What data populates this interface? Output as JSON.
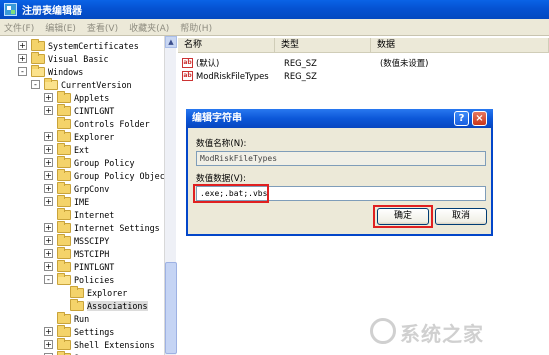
{
  "window": {
    "title": "注册表编辑器",
    "icon": "registry-icon"
  },
  "menu": [
    "文件(F)",
    "编辑(E)",
    "查看(V)",
    "收藏夹(A)",
    "帮助(H)"
  ],
  "tree": [
    {
      "label": "SystemCertificates",
      "exp": "+",
      "depth": 1
    },
    {
      "label": "Visual Basic",
      "exp": "+",
      "depth": 1
    },
    {
      "label": "Windows",
      "exp": "-",
      "depth": 1
    },
    {
      "label": "CurrentVersion",
      "exp": "-",
      "depth": 2
    },
    {
      "label": "Applets",
      "exp": "+",
      "depth": 3
    },
    {
      "label": "CINTLGNT",
      "exp": "+",
      "depth": 3
    },
    {
      "label": "Controls Folder",
      "exp": "",
      "depth": 3
    },
    {
      "label": "Explorer",
      "exp": "+",
      "depth": 3
    },
    {
      "label": "Ext",
      "exp": "+",
      "depth": 3
    },
    {
      "label": "Group Policy",
      "exp": "+",
      "depth": 3
    },
    {
      "label": "Group Policy Objec",
      "exp": "+",
      "depth": 3
    },
    {
      "label": "GrpConv",
      "exp": "+",
      "depth": 3
    },
    {
      "label": "IME",
      "exp": "+",
      "depth": 3
    },
    {
      "label": "Internet",
      "exp": "",
      "depth": 3
    },
    {
      "label": "Internet Settings",
      "exp": "+",
      "depth": 3
    },
    {
      "label": "MSSCIPY",
      "exp": "+",
      "depth": 3
    },
    {
      "label": "MSTCIPH",
      "exp": "+",
      "depth": 3
    },
    {
      "label": "PINTLGNT",
      "exp": "+",
      "depth": 3
    },
    {
      "label": "Policies",
      "exp": "-",
      "depth": 3
    },
    {
      "label": "Explorer",
      "exp": "",
      "depth": 4
    },
    {
      "label": "Associations",
      "exp": "",
      "depth": 4,
      "selected": true
    },
    {
      "label": "Run",
      "exp": "",
      "depth": 3
    },
    {
      "label": "Settings",
      "exp": "+",
      "depth": 3
    },
    {
      "label": "Shell Extensions",
      "exp": "+",
      "depth": 3
    },
    {
      "label": "Syncmgr",
      "exp": "+",
      "depth": 3
    }
  ],
  "list": {
    "columns": [
      "名称",
      "类型",
      "数据"
    ],
    "rows": [
      {
        "name": "(默认)",
        "type": "REG_SZ",
        "data": "(数值未设置)"
      },
      {
        "name": "ModRiskFileTypes",
        "type": "REG_SZ",
        "data": ""
      }
    ]
  },
  "dialog": {
    "title": "编辑字符串",
    "name_label": "数值名称(N):",
    "name_value": "ModRiskFileTypes",
    "data_label": "数值数据(V):",
    "data_value": ".exe;.bat;.vbs",
    "ok": "确定",
    "cancel": "取消",
    "help": "?",
    "close": "×"
  },
  "watermark": "系统之家"
}
